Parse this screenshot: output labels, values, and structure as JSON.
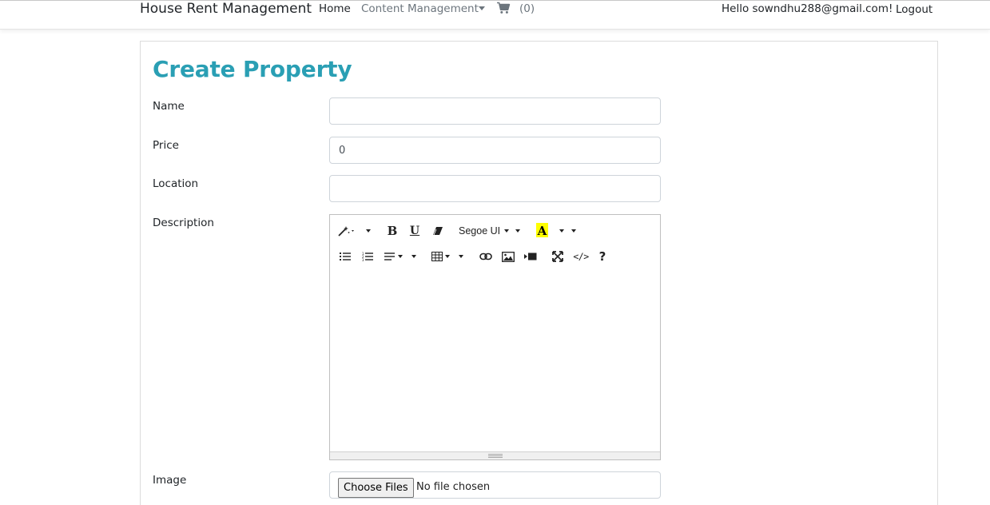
{
  "navbar": {
    "brand": "House Rent Management",
    "home": "Home",
    "content_management": "Content Management",
    "cart_count": "(0)",
    "greeting": "Hello sowndhu288@gmail.com!",
    "logout": "Logout"
  },
  "page": {
    "title": "Create Property"
  },
  "form": {
    "name_label": "Name",
    "name_value": "",
    "price_label": "Price",
    "price_value": "0",
    "location_label": "Location",
    "location_value": "",
    "description_label": "Description",
    "image_label": "Image",
    "choose_files": "Choose Files",
    "file_status": "No file chosen"
  },
  "editor": {
    "font_name": "Segoe UI",
    "highlight_color": "#ffff00",
    "toolbar_row1": [
      "magic-icon",
      "bold-icon",
      "underline-icon",
      "eraser-icon",
      "font-family-dropdown",
      "text-color-icon",
      "color-dropdown"
    ],
    "toolbar_row2": [
      "unordered-list-icon",
      "ordered-list-icon",
      "paragraph-align-icon",
      "table-icon",
      "link-icon",
      "picture-icon",
      "video-icon",
      "fullscreen-icon",
      "code-view-icon",
      "help-icon"
    ]
  },
  "colors": {
    "title": "#2a9fb4",
    "muted": "#6c757d"
  }
}
